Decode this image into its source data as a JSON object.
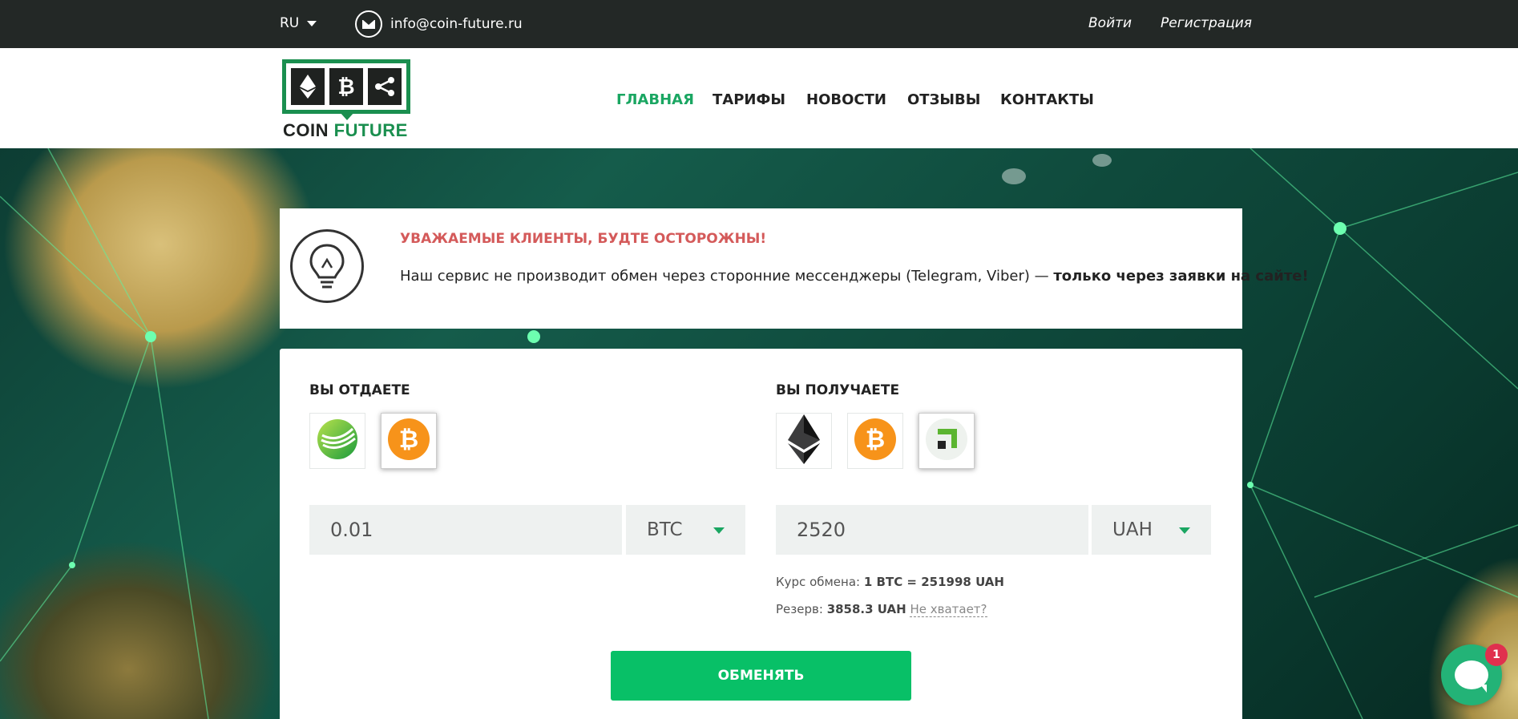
{
  "topbar": {
    "language": "RU",
    "email": "info@coin-future.ru",
    "login": "Войти",
    "register": "Регистрация"
  },
  "logo": {
    "word1": "COIN",
    "word2": "FUTURE",
    "icons": [
      "ethereum-icon",
      "bitcoin-icon",
      "ripple-icon"
    ]
  },
  "nav": {
    "items": [
      {
        "label": "ГЛАВНАЯ",
        "active": true
      },
      {
        "label": "ТАРИФЫ",
        "active": false
      },
      {
        "label": "НОВОСТИ",
        "active": false
      },
      {
        "label": "ОТЗЫВЫ",
        "active": false
      },
      {
        "label": "КОНТАКТЫ",
        "active": false
      }
    ]
  },
  "notice": {
    "title": "УВАЖАЕМЫЕ КЛИЕНТЫ, БУДТЕ ОСТОРОЖНЫ!",
    "text": "Наш сервис не производит обмен через сторонние мессенджеры (Telegram, Viber) — ",
    "text_bold": "только через заявки на сайте!"
  },
  "exchange": {
    "give": {
      "label": "ВЫ ОТДАЕТЕ",
      "methods": [
        "sberbank-icon",
        "bitcoin-icon"
      ],
      "selected": "bitcoin-icon",
      "amount": "0.01",
      "currency": "BTC"
    },
    "receive": {
      "label": "ВЫ ПОЛУЧАЕТЕ",
      "methods": [
        "ethereum-icon",
        "bitcoin-icon",
        "privatbank-icon"
      ],
      "selected": "privatbank-icon",
      "amount": "2520",
      "currency": "UAH"
    },
    "rate_label": "Курс обмена:",
    "rate_value": "1 BTC = 251998 UAH",
    "reserve_label": "Резерв:",
    "reserve_value": "3858.3 UAH",
    "reserve_link": "Не хватает?",
    "submit": "ОБМЕНЯТЬ"
  },
  "chat": {
    "badge": "1"
  },
  "colors": {
    "brand_green": "#1a8f4f",
    "accent_green": "#08c067",
    "warning_red": "#d45a5a",
    "topbar_bg": "#232826"
  }
}
